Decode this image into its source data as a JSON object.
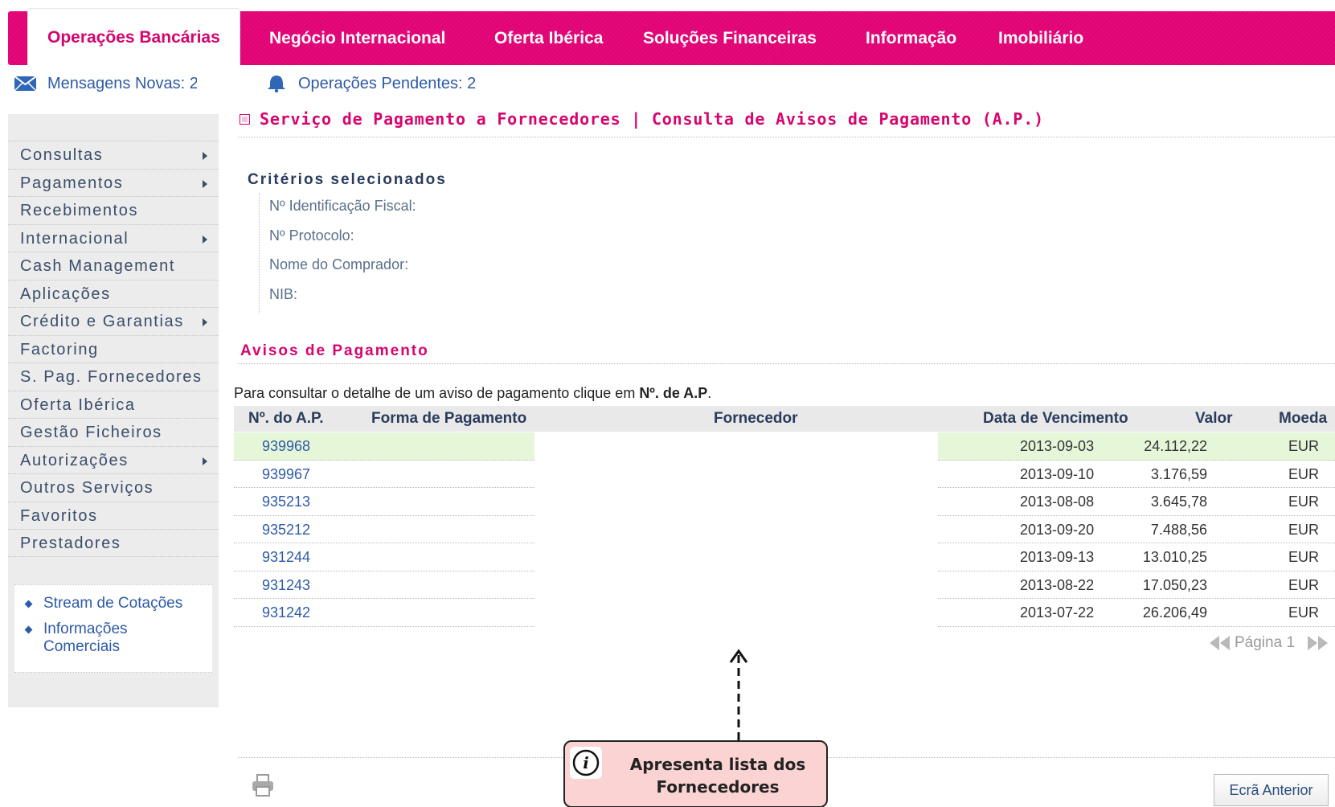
{
  "nav": {
    "tabs": [
      "Operações Bancárias",
      "Negócio Internacional",
      "Oferta Ibérica",
      "Soluções Financeiras",
      "Informação",
      "Imobiliário"
    ]
  },
  "messages": {
    "new_messages": "Mensagens Novas: 2",
    "pending_ops": "Operações Pendentes: 2"
  },
  "page": {
    "title": "Serviço de Pagamento a Fornecedores | Consulta de Avisos de Pagamento (A.P.)"
  },
  "sidebar": {
    "items": [
      {
        "label": "Consultas",
        "has_submenu": true
      },
      {
        "label": "Pagamentos",
        "has_submenu": true
      },
      {
        "label": "Recebimentos",
        "has_submenu": false
      },
      {
        "label": "Internacional",
        "has_submenu": true
      },
      {
        "label": "Cash Management",
        "has_submenu": false
      },
      {
        "label": "Aplicações",
        "has_submenu": false
      },
      {
        "label": "Crédito e Garantias",
        "has_submenu": true
      },
      {
        "label": "Factoring",
        "has_submenu": false
      },
      {
        "label": "S. Pag. Fornecedores",
        "has_submenu": false
      },
      {
        "label": "Oferta Ibérica",
        "has_submenu": false
      },
      {
        "label": "Gestão Ficheiros",
        "has_submenu": false
      },
      {
        "label": "Autorizações",
        "has_submenu": true
      },
      {
        "label": "Outros Serviços",
        "has_submenu": false
      },
      {
        "label": "Favoritos",
        "has_submenu": false
      },
      {
        "label": "Prestadores",
        "has_submenu": false
      }
    ],
    "links": [
      "Stream de Cotações",
      "Informações Comerciais"
    ]
  },
  "criteria": {
    "title": "Critérios selecionados",
    "fields": [
      "Nº Identificação Fiscal:",
      "Nº Protocolo:",
      "Nome do Comprador:",
      "NIB:"
    ]
  },
  "avisos": {
    "title": "Avisos de Pagamento",
    "info_prefix": "Para consultar o detalhe de um aviso de pagamento clique em ",
    "info_bold": "Nº. de A.P",
    "info_suffix": "."
  },
  "table": {
    "headers": [
      "Nº. do A.P.",
      "Forma de Pagamento",
      "Fornecedor",
      "Data de Vencimento",
      "Valor",
      "Moeda"
    ],
    "rows": [
      {
        "ap": "939968",
        "date": "2013-09-03",
        "value": "24.112,22",
        "currency": "EUR",
        "highlight": true
      },
      {
        "ap": "939967",
        "date": "2013-09-10",
        "value": "3.176,59",
        "currency": "EUR",
        "highlight": false
      },
      {
        "ap": "935213",
        "date": "2013-08-08",
        "value": "3.645,78",
        "currency": "EUR",
        "highlight": false
      },
      {
        "ap": "935212",
        "date": "2013-09-20",
        "value": "7.488,56",
        "currency": "EUR",
        "highlight": false
      },
      {
        "ap": "931244",
        "date": "2013-09-13",
        "value": "13.010,25",
        "currency": "EUR",
        "highlight": false
      },
      {
        "ap": "931243",
        "date": "2013-08-22",
        "value": "17.050,23",
        "currency": "EUR",
        "highlight": false
      },
      {
        "ap": "931242",
        "date": "2013-07-22",
        "value": "26.206,49",
        "currency": "EUR",
        "highlight": false
      }
    ]
  },
  "pager": {
    "label": "Página 1"
  },
  "callout": {
    "text": "Apresenta lista dos Fornecedores"
  },
  "buttons": {
    "back": "Ecrã Anterior"
  },
  "colors": {
    "brand_magenta": "#e5087a",
    "link_blue": "#2e5aa8",
    "highlight_row": "#e6f7d9",
    "callout_bg": "#fbd3d3"
  }
}
